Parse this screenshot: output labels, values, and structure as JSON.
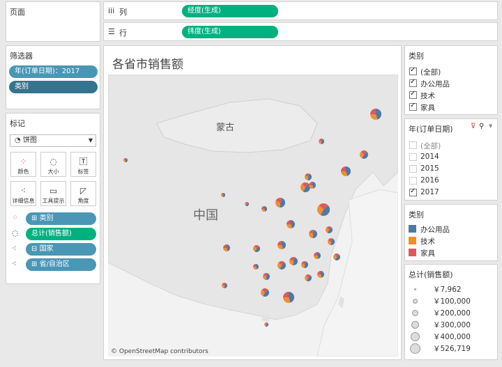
{
  "pages_panel": {
    "title": "页面"
  },
  "columns_shelf": {
    "icon": "iii",
    "label": "列",
    "pill": "经度(生成)"
  },
  "rows_shelf": {
    "icon": "☰",
    "label": "行",
    "pill": "纬度(生成)"
  },
  "filters_panel": {
    "title": "筛选器",
    "pills": [
      "年(订单日期)：2017",
      "类别"
    ]
  },
  "marks_panel": {
    "title": "标记",
    "mark_type": "饼图",
    "buttons": [
      {
        "label": "颜色",
        "icon": "palette-icon"
      },
      {
        "label": "大小",
        "icon": "size-icon"
      },
      {
        "label": "标签",
        "icon": "label-icon"
      },
      {
        "label": "详细信息",
        "icon": "detail-icon"
      },
      {
        "label": "工具提示",
        "icon": "tooltip-icon"
      },
      {
        "label": "角度",
        "icon": "angle-icon"
      }
    ],
    "fields": [
      {
        "label": "类别",
        "role": "color",
        "style": "blue"
      },
      {
        "label": "总计(销售额)",
        "role": "size",
        "style": "green"
      },
      {
        "label": "国家",
        "role": "detail",
        "style": "blue"
      },
      {
        "label": "省/自治区",
        "role": "detail",
        "style": "blue"
      }
    ]
  },
  "view": {
    "title": "各省市销售额",
    "map_labels": {
      "mongolia": "蒙古",
      "china": "中国"
    },
    "attribution": "© OpenStreetMap contributors"
  },
  "category_filter": {
    "title": "类别",
    "items": [
      {
        "label": "(全部)",
        "checked": true
      },
      {
        "label": "办公用品",
        "checked": true
      },
      {
        "label": "技术",
        "checked": true
      },
      {
        "label": "家具",
        "checked": true
      }
    ]
  },
  "year_filter": {
    "title": "年(订单日期)",
    "items": [
      {
        "label": "(全部)",
        "checked": false
      },
      {
        "label": "2014",
        "checked": false
      },
      {
        "label": "2015",
        "checked": false
      },
      {
        "label": "2016",
        "checked": false
      },
      {
        "label": "2017",
        "checked": true
      }
    ]
  },
  "color_legend": {
    "title": "类别",
    "items": [
      {
        "label": "办公用品",
        "color": "#4e79a7"
      },
      {
        "label": "技术",
        "color": "#f28e2b"
      },
      {
        "label": "家具",
        "color": "#e15759"
      }
    ]
  },
  "size_legend": {
    "title": "总计(销售额)",
    "items": [
      "￥7,962",
      "￥100,000",
      "￥200,000",
      "￥300,000",
      "￥400,000",
      "￥526,719"
    ]
  },
  "colors": {
    "green_pill": "#00b180",
    "blue_pill": "#4a96b5",
    "office": "#4e79a7",
    "tech": "#f28e2b",
    "furniture": "#e15759"
  }
}
